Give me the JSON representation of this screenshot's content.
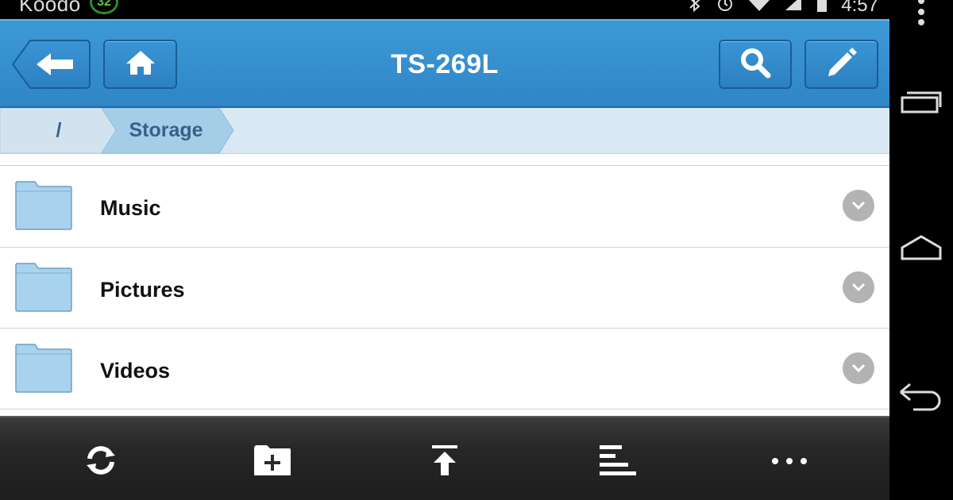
{
  "status_bar": {
    "carrier": "Koodo",
    "notification_badge": "32",
    "time": "4:57",
    "icons": [
      "bluetooth-icon",
      "alarm-icon",
      "wifi-icon",
      "signal-icon",
      "battery-icon"
    ]
  },
  "header": {
    "title": "TS-269L",
    "buttons": [
      "back-arrow-icon",
      "home-icon",
      "search-icon",
      "pencil-icon"
    ]
  },
  "breadcrumb": {
    "root": "/",
    "current": "Storage"
  },
  "files": [
    {
      "name": "Music",
      "icon": "folder-icon"
    },
    {
      "name": "Pictures",
      "icon": "folder-icon"
    },
    {
      "name": "Videos",
      "icon": "folder-icon"
    }
  ],
  "toolbar": {
    "icons": [
      "refresh-icon",
      "new-folder-icon",
      "upload-icon",
      "sort-icon",
      "more-icon"
    ]
  },
  "nav_bar": {
    "icons": [
      "overflow-menu-icon",
      "recent-apps-icon",
      "home-nav-icon",
      "back-nav-icon"
    ]
  },
  "colors": {
    "header_blue": "#3390d0",
    "breadcrumb_bg": "#d9e8f2",
    "crumb_text": "#35608a",
    "toolbar_bg": "#262626",
    "folder_fill": "#a9d2ee"
  }
}
